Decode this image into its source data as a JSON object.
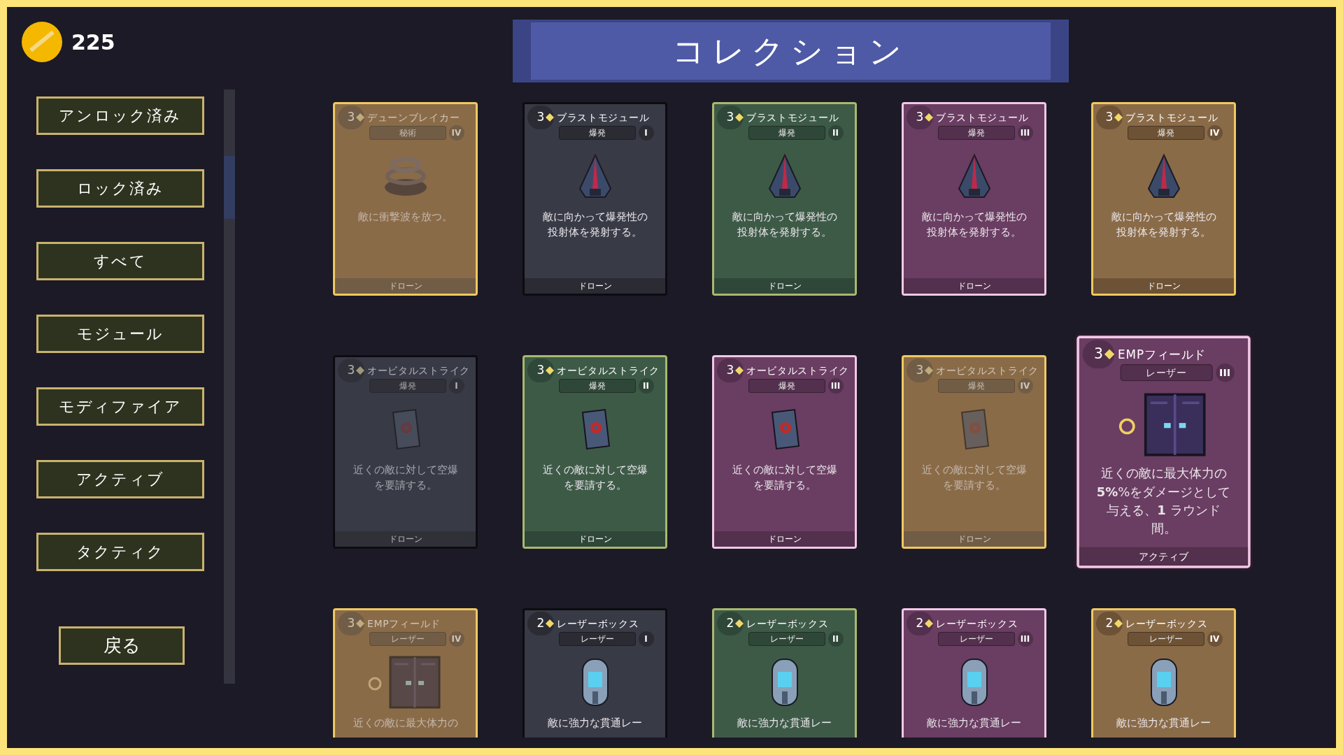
{
  "currency": {
    "amount": "225"
  },
  "title": "コレクション",
  "filters": [
    {
      "label": "アンロック済み"
    },
    {
      "label": "ロック済み"
    },
    {
      "label": "すべて"
    },
    {
      "label": "モジュール"
    },
    {
      "label": "モディファイア"
    },
    {
      "label": "アクティブ"
    },
    {
      "label": "タクティク"
    }
  ],
  "back_button": "戻る",
  "cards": [
    {
      "cost": "3",
      "name": "デューンブレイカー",
      "tag": "秘術",
      "tier": "IV",
      "kind": "rings",
      "description": "敵に衝撃波を放つ。",
      "category": "ドローン",
      "color": "#f0c860",
      "locked": true,
      "selected": false
    },
    {
      "cost": "3",
      "name": "ブラストモジュール",
      "tag": "爆発",
      "tier": "I",
      "kind": "cone",
      "description": "敵に向かって爆発性の投射体を発射する。",
      "category": "ドローン",
      "color": "#0c0c10",
      "locked": false,
      "selected": false
    },
    {
      "cost": "3",
      "name": "ブラストモジュール",
      "tag": "爆発",
      "tier": "II",
      "kind": "cone",
      "description": "敵に向かって爆発性の投射体を発射する。",
      "category": "ドローン",
      "color": "#a9b86e",
      "locked": false,
      "selected": false
    },
    {
      "cost": "3",
      "name": "ブラストモジュール",
      "tag": "爆発",
      "tier": "III",
      "kind": "cone",
      "description": "敵に向かって爆発性の投射体を発射する。",
      "category": "ドローン",
      "color": "#f0c8e6",
      "locked": false,
      "selected": false
    },
    {
      "cost": "3",
      "name": "ブラストモジュール",
      "tag": "爆発",
      "tier": "IV",
      "kind": "cone",
      "description": "敵に向かって爆発性の投射体を発射する。",
      "category": "ドローン",
      "color": "#f0c860",
      "locked": false,
      "selected": false
    },
    {
      "cost": "3",
      "name": "オービタルストライク",
      "tag": "爆発",
      "tier": "I",
      "kind": "tablet",
      "description": "近くの敵に対して空爆を要請する。",
      "category": "ドローン",
      "color": "#0c0c10",
      "locked": true,
      "selected": false
    },
    {
      "cost": "3",
      "name": "オービタルストライク",
      "tag": "爆発",
      "tier": "II",
      "kind": "tablet",
      "description": "近くの敵に対して空爆を要請する。",
      "category": "ドローン",
      "color": "#a9b86e",
      "locked": false,
      "selected": false
    },
    {
      "cost": "3",
      "name": "オービタルストライク",
      "tag": "爆発",
      "tier": "III",
      "kind": "tablet",
      "description": "近くの敵に対して空爆を要請する。",
      "category": "ドローン",
      "color": "#f0c8e6",
      "locked": false,
      "selected": false
    },
    {
      "cost": "3",
      "name": "オービタルストライク",
      "tag": "爆発",
      "tier": "IV",
      "kind": "tablet",
      "description": "近くの敵に対して空爆を要請する。",
      "category": "ドローン",
      "color": "#f0c860",
      "locked": true,
      "selected": false
    },
    {
      "cost": "3",
      "name": "EMPフィールド",
      "tag": "レーザー",
      "tier": "III",
      "kind": "cube",
      "description": "近くの敵に最大体力の**5%**%をダメージとして与える、**1** ラウンド間。",
      "category": "アクティブ",
      "color": "#f0c8e6",
      "locked": false,
      "selected": true
    },
    {
      "cost": "3",
      "name": "EMPフィールド",
      "tag": "レーザー",
      "tier": "IV",
      "kind": "cube",
      "description": "近くの敵に最大体力の",
      "color": "#f0c860",
      "locked": true,
      "selected": false
    },
    {
      "cost": "2",
      "name": "レーザーボックス",
      "tag": "レーザー",
      "tier": "I",
      "kind": "capsule",
      "description": "敵に強力な貫通レー",
      "color": "#0c0c10",
      "locked": false,
      "selected": false
    },
    {
      "cost": "2",
      "name": "レーザーボックス",
      "tag": "レーザー",
      "tier": "II",
      "kind": "capsule",
      "description": "敵に強力な貫通レー",
      "color": "#a9b86e",
      "locked": false,
      "selected": false
    },
    {
      "cost": "2",
      "name": "レーザーボックス",
      "tag": "レーザー",
      "tier": "III",
      "kind": "capsule",
      "description": "敵に強力な貫通レー",
      "color": "#f0c8e6",
      "locked": false,
      "selected": false
    },
    {
      "cost": "2",
      "name": "レーザーボックス",
      "tag": "レーザー",
      "tier": "IV",
      "kind": "capsule",
      "description": "敵に強力な貫通レー",
      "color": "#f0c860",
      "locked": false,
      "selected": false
    }
  ]
}
